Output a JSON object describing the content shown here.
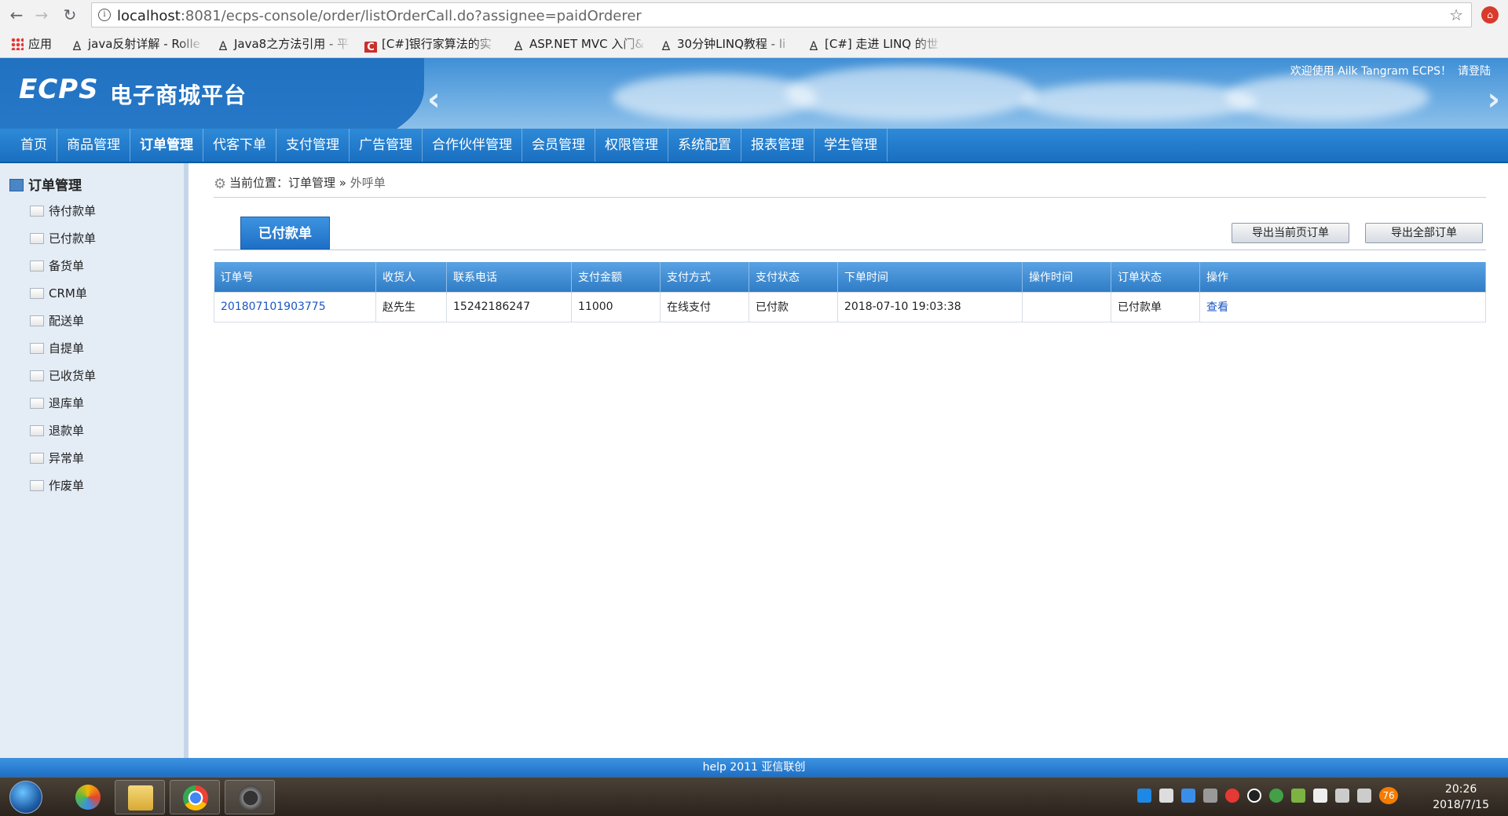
{
  "browser": {
    "url_host": "localhost",
    "url_rest": ":8081/ecps-console/order/listOrderCall.do?assignee=paidOrderer",
    "bookmarks": [
      {
        "label": "应用",
        "icon": "apps-icon"
      },
      {
        "label": "java反射详解 - Rolle",
        "icon": "angular-icon"
      },
      {
        "label": "Java8之方法引用 - 平",
        "icon": "angular-icon"
      },
      {
        "label": "[C#]银行家算法的实",
        "icon": "csdn-icon"
      },
      {
        "label": "ASP.NET MVC 入门&",
        "icon": "angular-icon"
      },
      {
        "label": "30分钟LINQ教程 - li",
        "icon": "angular-icon"
      },
      {
        "label": "[C#] 走进 LINQ 的世",
        "icon": "angular-icon"
      }
    ]
  },
  "header": {
    "logo": "ECPS",
    "subtitle": "电子商城平台",
    "welcome": "欢迎使用 Ailk Tangram ECPS！",
    "login": "请登陆"
  },
  "menu": [
    {
      "label": "首页",
      "active": false
    },
    {
      "label": "商品管理",
      "active": false
    },
    {
      "label": "订单管理",
      "active": true
    },
    {
      "label": "代客下单",
      "active": false
    },
    {
      "label": "支付管理",
      "active": false
    },
    {
      "label": "广告管理",
      "active": false
    },
    {
      "label": "合作伙伴管理",
      "active": false
    },
    {
      "label": "会员管理",
      "active": false
    },
    {
      "label": "权限管理",
      "active": false
    },
    {
      "label": "系统配置",
      "active": false
    },
    {
      "label": "报表管理",
      "active": false
    },
    {
      "label": "学生管理",
      "active": false
    }
  ],
  "sidebar": {
    "title": "订单管理",
    "items": [
      "待付款单",
      "已付款单",
      "备货单",
      "CRM单",
      "配送单",
      "自提单",
      "已收货单",
      "退库单",
      "退款单",
      "异常单",
      "作废单"
    ]
  },
  "breadcrumb": {
    "prefix": "当前位置：",
    "section": "订单管理",
    "sep": " » ",
    "current": "外呼单"
  },
  "tab": {
    "label": "已付款单"
  },
  "buttons": {
    "export_page": "导出当前页订单",
    "export_all": "导出全部订单"
  },
  "table": {
    "columns": [
      "订单号",
      "收货人",
      "联系电话",
      "支付金额",
      "支付方式",
      "支付状态",
      "下单时间",
      "操作时间",
      "订单状态",
      "操作"
    ],
    "rows": [
      {
        "order_no": "201807101903775",
        "receiver": "赵先生",
        "phone": "15242186247",
        "amount": "11000",
        "pay_method": "在线支付",
        "pay_status": "已付款",
        "order_time": "2018-07-10 19:03:38",
        "op_time": "",
        "order_status": "已付款单",
        "action": "查看"
      }
    ]
  },
  "footer": {
    "text": "help 2011 亚信联创"
  },
  "taskbar": {
    "time": "20:26",
    "date": "2018/7/15",
    "badge": "76"
  }
}
